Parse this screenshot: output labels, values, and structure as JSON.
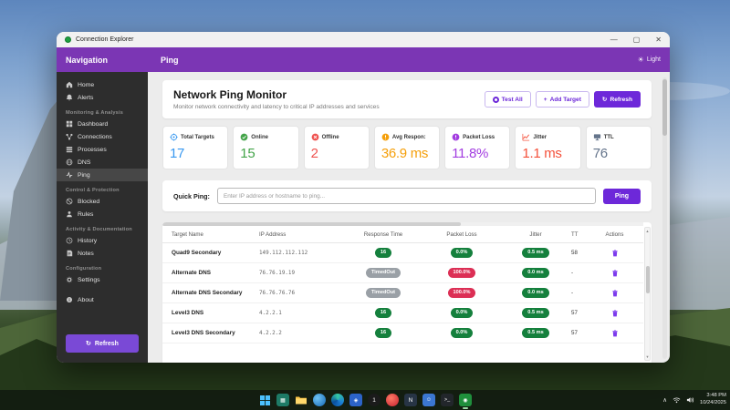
{
  "window": {
    "title": "Connection Explorer",
    "nav_header": "Navigation",
    "page_title": "Ping",
    "theme_toggle": "Light"
  },
  "sidebar": {
    "items": [
      {
        "label": "Home",
        "icon": "home-icon"
      },
      {
        "label": "Alerts",
        "icon": "bell-icon"
      },
      {
        "section": "Monitoring & Analysis"
      },
      {
        "label": "Dashboard",
        "icon": "dashboard-icon"
      },
      {
        "label": "Connections",
        "icon": "connections-icon"
      },
      {
        "label": "Processes",
        "icon": "processes-icon"
      },
      {
        "label": "DNS",
        "icon": "dns-icon"
      },
      {
        "label": "Ping",
        "icon": "ping-icon",
        "active": true
      },
      {
        "section": "Control & Protection"
      },
      {
        "label": "Blocked",
        "icon": "blocked-icon"
      },
      {
        "label": "Rules",
        "icon": "rules-icon"
      },
      {
        "section": "Activity & Documentation"
      },
      {
        "label": "History",
        "icon": "history-icon"
      },
      {
        "label": "Notes",
        "icon": "notes-icon"
      },
      {
        "section": "Configuration"
      },
      {
        "label": "Settings",
        "icon": "gear-icon"
      },
      {
        "label": "About",
        "icon": "info-icon"
      }
    ],
    "refresh_button": "Refresh"
  },
  "main": {
    "title": "Network Ping Monitor",
    "subtitle": "Monitor network connectivity and latency to critical IP addresses and services",
    "buttons": {
      "test_all": "Test All",
      "add_target": "Add Target",
      "refresh": "Refresh"
    },
    "stats": [
      {
        "label": "Total Targets",
        "value": "17",
        "color": "#3898f0",
        "icon": "target-icon"
      },
      {
        "label": "Online",
        "value": "15",
        "color": "#43a449",
        "icon": "check-circle-icon"
      },
      {
        "label": "Offline",
        "value": "2",
        "color": "#ef5350",
        "icon": "x-circle-icon"
      },
      {
        "label": "Avg Respon:",
        "value": "36.9 ms",
        "color": "#f59f0a",
        "icon": "alert-circle-icon"
      },
      {
        "label": "Packet Loss",
        "value": "11.8%",
        "color": "#a23ce0",
        "icon": "alert-circle-icon"
      },
      {
        "label": "Jitter",
        "value": "1.1 ms",
        "color": "#f4503a",
        "icon": "chart-line-icon"
      },
      {
        "label": "TTL",
        "value": "76",
        "color": "#64748b",
        "icon": "monitor-icon"
      }
    ],
    "quick_ping": {
      "label": "Quick Ping:",
      "placeholder": "Enter IP address or hostname to ping...",
      "button": "Ping"
    },
    "table": {
      "headers": [
        "Target Name",
        "IP Address",
        "Response Time",
        "Packet Loss",
        "Jitter",
        "TT",
        "Actions"
      ],
      "rows": [
        {
          "name": "Quad9 Secondary",
          "ip": "149.112.112.112",
          "response": "16",
          "loss": "0.0%",
          "jitter": "0.5 ms",
          "ttl": "58"
        },
        {
          "name": "Alternate DNS",
          "ip": "76.76.19.19",
          "response": "TimedOut",
          "loss": "100.0%",
          "jitter": "0.0 ms",
          "ttl": "-"
        },
        {
          "name": "Alternate DNS Secondary",
          "ip": "76.76.76.76",
          "response": "TimedOut",
          "loss": "100.0%",
          "jitter": "0.0 ms",
          "ttl": "-"
        },
        {
          "name": "Level3 DNS",
          "ip": "4.2.2.1",
          "response": "16",
          "loss": "0.0%",
          "jitter": "0.5 ms",
          "ttl": "57"
        },
        {
          "name": "Level3 DNS Secondary",
          "ip": "4.2.2.2",
          "response": "16",
          "loss": "0.0%",
          "jitter": "0.5 ms",
          "ttl": "57"
        }
      ]
    }
  },
  "taskbar": {
    "icons": [
      "start",
      "files-app",
      "file-explorer",
      "photos-app",
      "edge-browser",
      "dev-box",
      "onepassword",
      "media-app",
      "notepad",
      "chat-app",
      "terminal",
      "connection-explorer"
    ],
    "tray": {
      "time": "3:48 PM",
      "date": "10/24/2025"
    }
  },
  "colors": {
    "accent_purple": "#7b36b4",
    "button_purple": "#6d28d9",
    "badge_green": "#15803d",
    "badge_red": "#dc2f55",
    "badge_gray": "#9aa0a6"
  }
}
